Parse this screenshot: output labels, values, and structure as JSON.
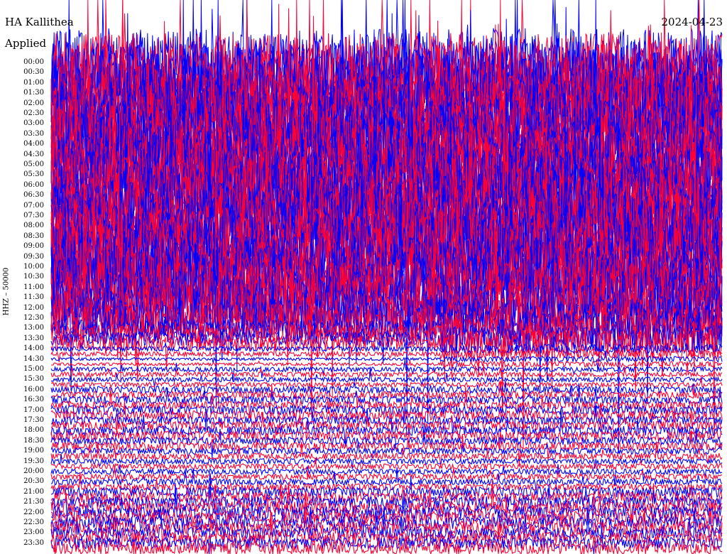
{
  "header": {
    "station": "HA Kallithea",
    "applied": "Applied",
    "date": "2024-04-23",
    "channel_label": "HHZ – 50000"
  },
  "colors": {
    "trace_a": "#0000ff",
    "trace_b": "#ff0033",
    "background": "#ffffff"
  },
  "chart_data": {
    "type": "helicorder",
    "title": "HA Kallithea",
    "date": "2024-04-23",
    "ylabel": "HHZ – 50000",
    "row_minutes": 15,
    "rows": 96,
    "time_labels": [
      "00:00",
      "00:30",
      "01:00",
      "01:30",
      "02:00",
      "02:30",
      "03:00",
      "03:30",
      "04:00",
      "04:30",
      "05:00",
      "05:30",
      "06:00",
      "06:30",
      "07:00",
      "07:30",
      "08:00",
      "08:30",
      "09:00",
      "09:30",
      "10:00",
      "10:30",
      "11:00",
      "11:30",
      "12:00",
      "12:30",
      "13:00",
      "13:30",
      "14:00",
      "14:30",
      "15:00",
      "15:30",
      "16:00",
      "16:30",
      "17:00",
      "17:30",
      "18:00",
      "18:30",
      "19:00",
      "19:30",
      "20:00",
      "20:30",
      "21:00",
      "21:30",
      "22:00",
      "22:30",
      "23:00",
      "23:30"
    ],
    "trace_colors": [
      "#0000ff",
      "#ff0033"
    ],
    "amplitude_by_half_hour": [
      9,
      9,
      9,
      9,
      9,
      9,
      9,
      9,
      9,
      9,
      9,
      9,
      9,
      9,
      9,
      9,
      9,
      9,
      9,
      9,
      8,
      8,
      8,
      7,
      6,
      5,
      4,
      3,
      1,
      0.6,
      0.6,
      0.6,
      0.9,
      1,
      1.2,
      1.1,
      1.2,
      1,
      0.8,
      0.7,
      0.7,
      0.8,
      1.3,
      1.5,
      1.6,
      1.6,
      1.5,
      1.5
    ]
  }
}
